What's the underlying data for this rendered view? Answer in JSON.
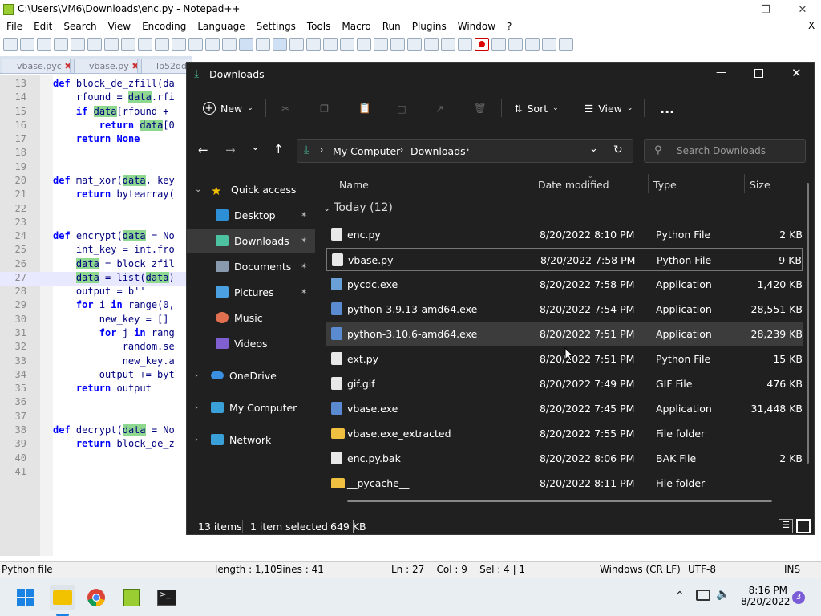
{
  "npp": {
    "title": "C:\\Users\\VM6\\Downloads\\enc.py - Notepad++",
    "menu": [
      "File",
      "Edit",
      "Search",
      "View",
      "Encoding",
      "Language",
      "Settings",
      "Tools",
      "Macro",
      "Run",
      "Plugins",
      "Window",
      "?"
    ],
    "close_x": "X",
    "tabs": [
      "vbase.pyc",
      "vbase.py",
      "lb52ddb"
    ],
    "lines": [
      {
        "n": "13",
        "code": "def block_de_zfill(da"
      },
      {
        "n": "14",
        "code": "    rfound = data.rfi"
      },
      {
        "n": "15",
        "code": "    if data[rfound +"
      },
      {
        "n": "16",
        "code": "        return data[0"
      },
      {
        "n": "17",
        "code": "    return None"
      },
      {
        "n": "18",
        "code": ""
      },
      {
        "n": "19",
        "code": ""
      },
      {
        "n": "20",
        "code": "def mat_xor(data, key"
      },
      {
        "n": "21",
        "code": "    return bytearray("
      },
      {
        "n": "22",
        "code": ""
      },
      {
        "n": "23",
        "code": ""
      },
      {
        "n": "24",
        "code": "def encrypt(data = No"
      },
      {
        "n": "25",
        "code": "    int_key = int.fro"
      },
      {
        "n": "26",
        "code": "    data = block_zfil"
      },
      {
        "n": "27",
        "code": "    data = list(data)"
      },
      {
        "n": "28",
        "code": "    output = b''"
      },
      {
        "n": "29",
        "code": "    for i in range(0,"
      },
      {
        "n": "30",
        "code": "        new_key = []"
      },
      {
        "n": "31",
        "code": "        for j in rang"
      },
      {
        "n": "32",
        "code": "            random.se"
      },
      {
        "n": "33",
        "code": "            new_key.a"
      },
      {
        "n": "34",
        "code": "        output += byt"
      },
      {
        "n": "35",
        "code": "    return output"
      },
      {
        "n": "36",
        "code": ""
      },
      {
        "n": "37",
        "code": ""
      },
      {
        "n": "38",
        "code": "def decrypt(data = No"
      },
      {
        "n": "39",
        "code": "    return block_de_z"
      },
      {
        "n": "40",
        "code": ""
      },
      {
        "n": "41",
        "code": ""
      }
    ],
    "status": {
      "filetype": "Python file",
      "length": "length : 1,105",
      "lines": "lines : 41",
      "pos": "Ln : 27    Col : 9    Sel : 4 | 1",
      "eol": "Windows (CR LF)",
      "enc": "UTF-8",
      "mode": "INS"
    }
  },
  "explorer": {
    "title": "Downloads",
    "cmd": {
      "new": "New",
      "sort": "Sort",
      "view": "View",
      "more": "..."
    },
    "path": [
      "My Computer",
      "Downloads"
    ],
    "search_placeholder": "Search Downloads",
    "nav": [
      {
        "label": "Quick access",
        "icon": "star-icon",
        "color": "#f2c200"
      },
      {
        "label": "Desktop",
        "icon": "desktop-icon",
        "color": "#2d8fd6"
      },
      {
        "label": "Downloads",
        "icon": "download-icon",
        "color": "#4cc2a0"
      },
      {
        "label": "Documents",
        "icon": "document-icon",
        "color": "#8a9aae"
      },
      {
        "label": "Pictures",
        "icon": "pictures-icon",
        "color": "#4aa0e0"
      },
      {
        "label": "Music",
        "icon": "music-icon",
        "color": "#e07050"
      },
      {
        "label": "Videos",
        "icon": "videos-icon",
        "color": "#8060d0"
      },
      {
        "label": "OneDrive",
        "icon": "cloud-icon",
        "color": "#3a8fe0"
      },
      {
        "label": "My Computer",
        "icon": "computer-icon",
        "color": "#3aa0d8"
      },
      {
        "label": "Network",
        "icon": "network-icon",
        "color": "#3aa0d8"
      }
    ],
    "columns": {
      "name": "Name",
      "date": "Date modified",
      "type": "Type",
      "size": "Size"
    },
    "group": "Today (12)",
    "files": [
      {
        "name": "enc.py",
        "date": "8/20/2022 8:10 PM",
        "type": "Python File",
        "size": "2 KB",
        "color": "#e8e8e8"
      },
      {
        "name": "vbase.py",
        "date": "8/20/2022 7:58 PM",
        "type": "Python File",
        "size": "9 KB",
        "color": "#e8e8e8"
      },
      {
        "name": "pycdc.exe",
        "date": "8/20/2022 7:58 PM",
        "type": "Application",
        "size": "1,420 KB",
        "color": "#6aa0d8"
      },
      {
        "name": "python-3.9.13-amd64.exe",
        "date": "8/20/2022 7:54 PM",
        "type": "Application",
        "size": "28,551 KB",
        "color": "#5a8ad0"
      },
      {
        "name": "python-3.10.6-amd64.exe",
        "date": "8/20/2022 7:51 PM",
        "type": "Application",
        "size": "28,239 KB",
        "color": "#5a8ad0"
      },
      {
        "name": "ext.py",
        "date": "8/20/2022 7:51 PM",
        "type": "Python File",
        "size": "15 KB",
        "color": "#e8e8e8"
      },
      {
        "name": "gif.gif",
        "date": "8/20/2022 7:49 PM",
        "type": "GIF File",
        "size": "476 KB",
        "color": "#e8e8e8"
      },
      {
        "name": "vbase.exe",
        "date": "8/20/2022 7:45 PM",
        "type": "Application",
        "size": "31,448 KB",
        "color": "#5a8ad0"
      },
      {
        "name": "vbase.exe_extracted",
        "date": "8/20/2022 7:55 PM",
        "type": "File folder",
        "size": "",
        "color": "#f0c040"
      },
      {
        "name": "enc.py.bak",
        "date": "8/20/2022 8:06 PM",
        "type": "BAK File",
        "size": "2 KB",
        "color": "#e8e8e8"
      },
      {
        "name": "__pycache__",
        "date": "8/20/2022 8:11 PM",
        "type": "File folder",
        "size": "",
        "color": "#f0c040"
      }
    ],
    "status": {
      "count": "13 items",
      "selected": "1 item selected",
      "size": "649 KB"
    }
  },
  "taskbar": {
    "time": "8:16 PM",
    "date": "8/20/2022",
    "badge": "3"
  }
}
